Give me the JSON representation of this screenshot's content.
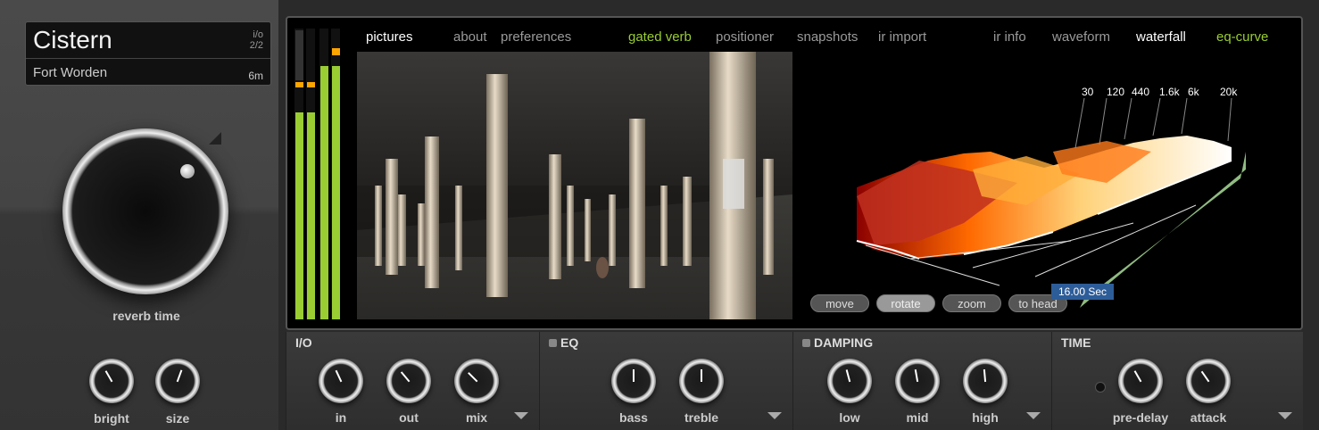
{
  "preset": {
    "name": "Cistern",
    "count_top": "i/o",
    "count_bottom": "2/2",
    "location": "Fort Worden",
    "size": "6m"
  },
  "main_knob": {
    "label": "reverb time"
  },
  "left_knobs": [
    {
      "label": "bright"
    },
    {
      "label": "size"
    }
  ],
  "tabs": {
    "pictures": "pictures",
    "about": "about",
    "preferences": "preferences",
    "gated_verb": "gated verb",
    "positioner": "positioner",
    "snapshots": "snapshots",
    "ir_import": "ir import",
    "ir_info": "ir info",
    "waveform": "waveform",
    "waterfall": "waterfall",
    "eq_curve": "eq-curve"
  },
  "waterfall": {
    "freq_labels": [
      "30",
      "120",
      "440",
      "1.6k",
      "6k",
      "20k"
    ],
    "buttons": {
      "move": "move",
      "rotate": "rotate",
      "zoom": "zoom",
      "to_head": "to head"
    },
    "time_readout": "16.00 Sec"
  },
  "sections": {
    "io": {
      "title": "I/O",
      "knobs": [
        "in",
        "out",
        "mix"
      ]
    },
    "eq": {
      "title": "EQ",
      "knobs": [
        "bass",
        "treble"
      ]
    },
    "damping": {
      "title": "DAMPING",
      "knobs": [
        "low",
        "mid",
        "high"
      ]
    },
    "time": {
      "title": "TIME",
      "knobs": [
        "pre-delay",
        "attack"
      ]
    }
  },
  "colors": {
    "accent_green": "#9acd32",
    "meter_green": "#9acd32",
    "meter_orange": "#ffa500"
  }
}
